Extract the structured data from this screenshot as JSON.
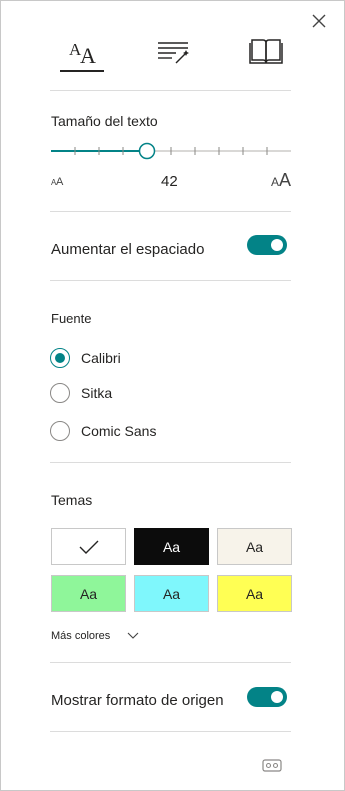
{
  "close_icon": "close-icon",
  "tabs": [
    {
      "name": "text-preferences",
      "icon": "text-size-icon",
      "selected": true
    },
    {
      "name": "grammar-options",
      "icon": "grammar-wand-icon",
      "selected": false
    },
    {
      "name": "reading-preferences",
      "icon": "book-icon",
      "selected": false
    }
  ],
  "text_size": {
    "label": "Tamaño del texto",
    "value": "42",
    "small_icon": "small-text-icon",
    "large_icon": "large-text-icon",
    "level_fraction": 0.4
  },
  "spacing": {
    "label": "Aumentar el espaciado",
    "on": true
  },
  "font": {
    "label": "Fuente",
    "options": [
      "Calibri",
      "Sitka",
      "Comic Sans"
    ],
    "selected": "Calibri"
  },
  "themes": {
    "label": "Temas",
    "swatch_text": "Aa",
    "swatches": [
      {
        "bg": "#ffffff",
        "fg": "#252423",
        "selected": true
      },
      {
        "bg": "#0c0c0c",
        "fg": "#ffffff",
        "selected": false
      },
      {
        "bg": "#f7f3ea",
        "fg": "#252423",
        "selected": false
      },
      {
        "bg": "#8ff69a",
        "fg": "#252423",
        "selected": false
      },
      {
        "bg": "#7ff7fc",
        "fg": "#252423",
        "selected": false
      },
      {
        "bg": "#ffff54",
        "fg": "#252423",
        "selected": false
      }
    ],
    "more_colors": "Más colores"
  },
  "source_format": {
    "label": "Mostrar formato de origen",
    "on": true
  },
  "accent_color": "#038387",
  "bottom_icon": "immersive-reader-icon"
}
